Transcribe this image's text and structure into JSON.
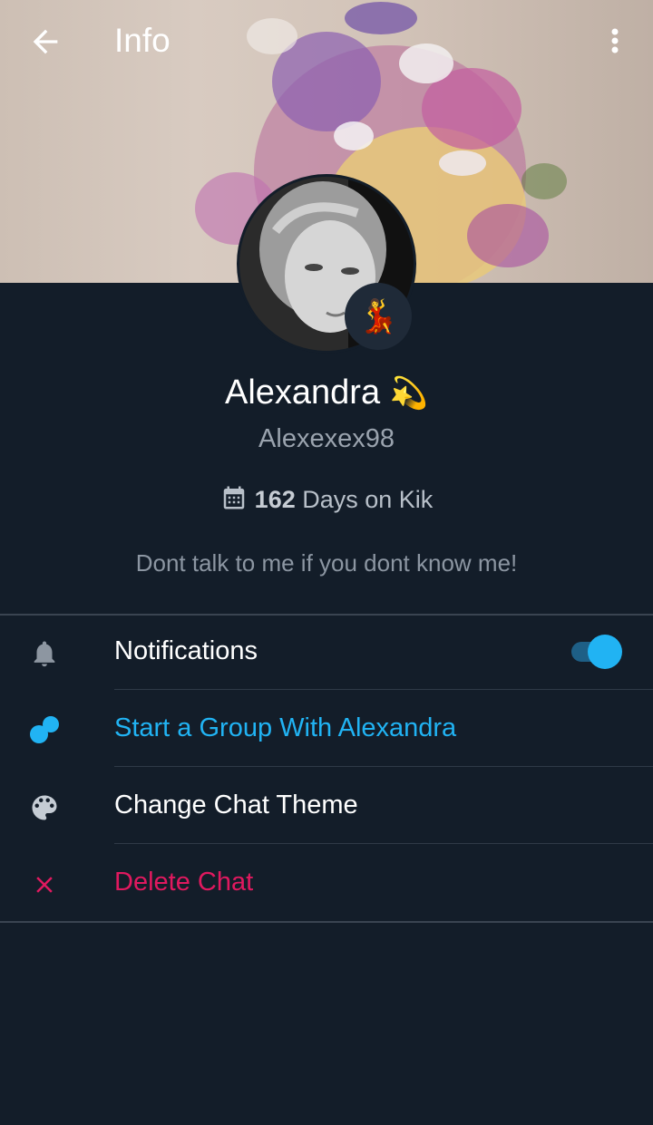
{
  "header": {
    "title": "Info"
  },
  "profile": {
    "display_name": "Alexandra",
    "name_emoji": "💫",
    "username": "Alexexex98",
    "days_count": "162",
    "days_label": "Days on Kik",
    "bio": "Dont talk to me if you dont know me!",
    "mood_emoji": "💃"
  },
  "menu": {
    "notifications": {
      "label": "Notifications",
      "enabled": true
    },
    "start_group": {
      "label": "Start a Group With Alexandra"
    },
    "change_theme": {
      "label": "Change Chat Theme"
    },
    "delete_chat": {
      "label": "Delete Chat"
    }
  },
  "colors": {
    "background": "#131d29",
    "accent_blue": "#21b3f3",
    "delete_pink": "#e0195f",
    "muted_text": "#9aa3ae"
  },
  "icons": [
    "back-arrow-icon",
    "more-vert-icon",
    "calendar-icon",
    "bell-icon",
    "group-icon",
    "palette-icon",
    "close-icon"
  ]
}
